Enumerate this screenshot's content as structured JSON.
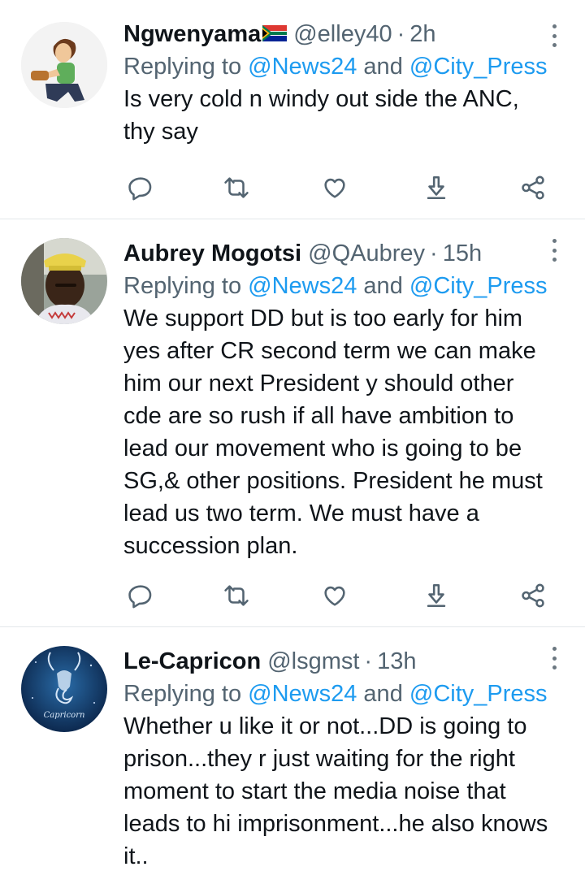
{
  "tweets": [
    {
      "name": "Ngwenyama",
      "handle": "@elley40",
      "separator": "·",
      "time": "2h",
      "replying_prefix": "Replying to ",
      "replying_a": "@News24",
      "replying_and": " and ",
      "replying_b": "@City_Press",
      "text": "Is very cold n windy out side the ANC,\nthy say"
    },
    {
      "name": "Aubrey Mogotsi",
      "handle": "@QAubrey",
      "separator": "·",
      "time": "15h",
      "replying_prefix": "Replying to ",
      "replying_a": "@News24",
      "replying_and": " and ",
      "replying_b": "@City_Press",
      "text": "We support DD but is too early for him\nyes after CR second term we can make\nhim our next President y should other\ncde are so rush if all have ambition to\nlead our movement who is going to be\nSG,& other positions. President he must\nlead us two term. We must have a\nsuccession plan."
    },
    {
      "name": "Le-Capricon",
      "handle": "@lsgmst",
      "separator": "·",
      "time": "13h",
      "replying_prefix": "Replying to ",
      "replying_a": "@News24",
      "replying_and": " and ",
      "replying_b": "@City_Press",
      "text": "Whether u like it or not...DD is going to\nprison...they r just waiting for the right\nmoment to start the media noise that\nleads to hi imprisonment...he also knows\nit..",
      "avatar_text": "Capricorn"
    }
  ],
  "icons": {
    "reply": "reply-icon",
    "retweet": "retweet-icon",
    "like": "heart-icon",
    "download": "download-icon",
    "share": "share-icon",
    "more": "more-vertical-icon"
  },
  "colors": {
    "text": "#0f1419",
    "secondary": "#536471",
    "link": "#1d9bf0",
    "icon": "#536471",
    "divider": "#e3e7ea"
  }
}
